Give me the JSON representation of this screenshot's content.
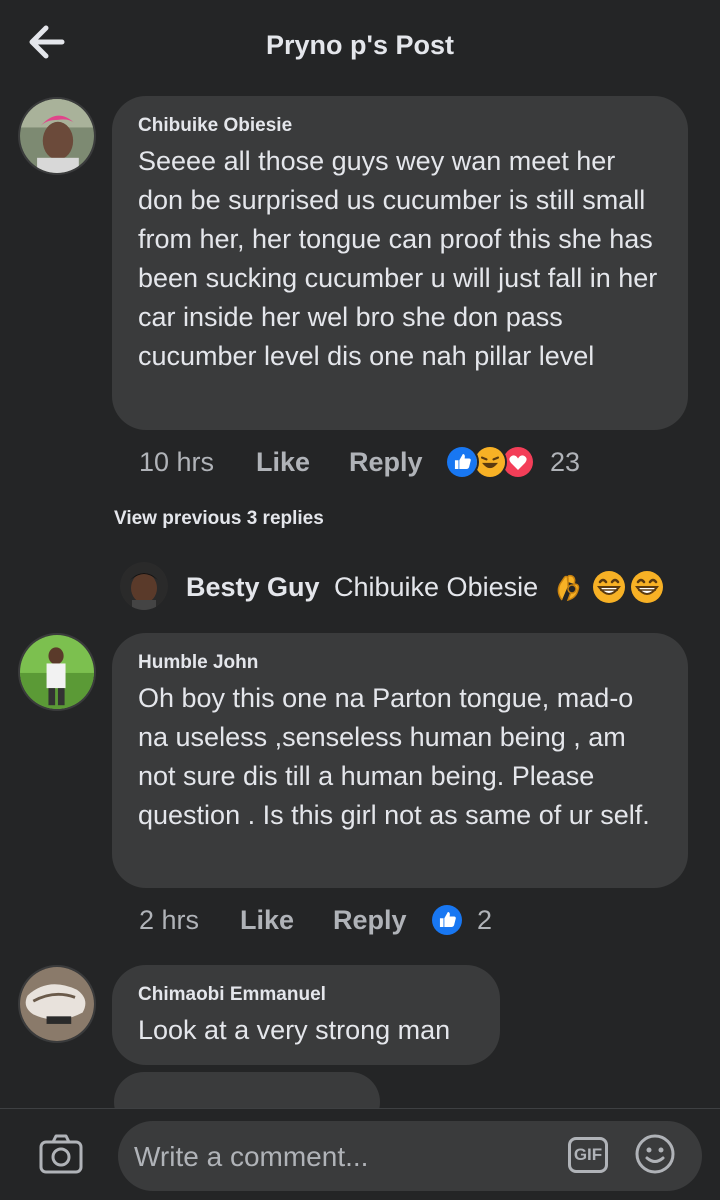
{
  "header": {
    "title": "Pryno p's Post"
  },
  "comments": [
    {
      "author": "Chibuike Obiesie",
      "text": "Seeee all those guys wey wan meet her don be surprised us cucumber is still small from her, her tongue can proof this she has been sucking cucumber  u will just fall in her car inside her wel bro she don pass cucumber level dis one nah pillar level",
      "time": "10 hrs",
      "like_label": "Like",
      "reply_label": "Reply",
      "reaction_count": "23",
      "reactions": [
        "like-reaction-icon",
        "haha-reaction-icon",
        "love-reaction-icon"
      ]
    },
    {
      "author": "Humble John",
      "text": "Oh boy this one na Parton tongue, mad-o na useless ,senseless human being , am not sure dis till a human being. Please question . Is this girl not as same of ur self.",
      "time": "2 hrs",
      "like_label": "Like",
      "reply_label": "Reply",
      "reaction_count": "2",
      "reactions": [
        "like-reaction-icon"
      ]
    },
    {
      "author": "Chimaobi Emmanuel",
      "text": "Look at a very strong man"
    }
  ],
  "view_previous": "View previous 3 replies",
  "reply_preview": {
    "author": "Besty Guy",
    "text": "Chibuike Obiesie",
    "emojis": [
      "ok-hand-emoji",
      "grinning-emoji",
      "grinning-emoji"
    ]
  },
  "composer": {
    "placeholder": "Write a comment...",
    "gif_label": "GIF",
    "icons": [
      "camera-icon",
      "gif-icon",
      "smiley-icon"
    ]
  },
  "colors": {
    "background": "#242526",
    "bubble": "#3a3b3c",
    "text": "#e4e6eb",
    "secondary_text": "#b0b3b8",
    "like_blue": "#1877f2",
    "love_red": "#f33e58",
    "haha_yellow": "#f7b125"
  }
}
